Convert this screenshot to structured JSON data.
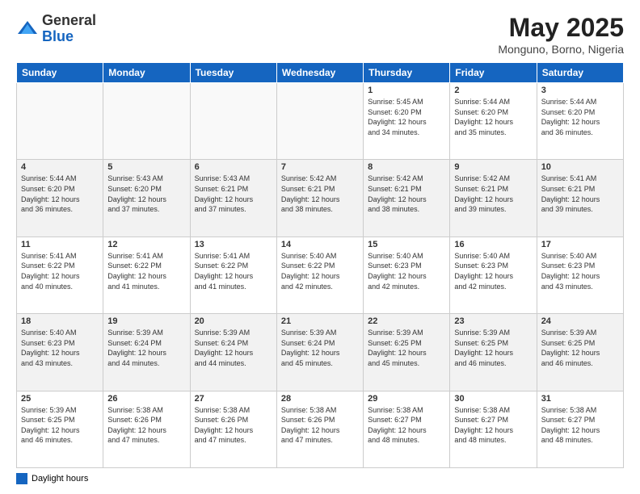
{
  "header": {
    "logo_general": "General",
    "logo_blue": "Blue",
    "month_title": "May 2025",
    "subtitle": "Monguno, Borno, Nigeria"
  },
  "days_of_week": [
    "Sunday",
    "Monday",
    "Tuesday",
    "Wednesday",
    "Thursday",
    "Friday",
    "Saturday"
  ],
  "footer": {
    "legend_label": "Daylight hours"
  },
  "weeks": [
    [
      {
        "day": "",
        "info": ""
      },
      {
        "day": "",
        "info": ""
      },
      {
        "day": "",
        "info": ""
      },
      {
        "day": "",
        "info": ""
      },
      {
        "day": "1",
        "info": "Sunrise: 5:45 AM\nSunset: 6:20 PM\nDaylight: 12 hours\nand 34 minutes."
      },
      {
        "day": "2",
        "info": "Sunrise: 5:44 AM\nSunset: 6:20 PM\nDaylight: 12 hours\nand 35 minutes."
      },
      {
        "day": "3",
        "info": "Sunrise: 5:44 AM\nSunset: 6:20 PM\nDaylight: 12 hours\nand 36 minutes."
      }
    ],
    [
      {
        "day": "4",
        "info": "Sunrise: 5:44 AM\nSunset: 6:20 PM\nDaylight: 12 hours\nand 36 minutes."
      },
      {
        "day": "5",
        "info": "Sunrise: 5:43 AM\nSunset: 6:20 PM\nDaylight: 12 hours\nand 37 minutes."
      },
      {
        "day": "6",
        "info": "Sunrise: 5:43 AM\nSunset: 6:21 PM\nDaylight: 12 hours\nand 37 minutes."
      },
      {
        "day": "7",
        "info": "Sunrise: 5:42 AM\nSunset: 6:21 PM\nDaylight: 12 hours\nand 38 minutes."
      },
      {
        "day": "8",
        "info": "Sunrise: 5:42 AM\nSunset: 6:21 PM\nDaylight: 12 hours\nand 38 minutes."
      },
      {
        "day": "9",
        "info": "Sunrise: 5:42 AM\nSunset: 6:21 PM\nDaylight: 12 hours\nand 39 minutes."
      },
      {
        "day": "10",
        "info": "Sunrise: 5:41 AM\nSunset: 6:21 PM\nDaylight: 12 hours\nand 39 minutes."
      }
    ],
    [
      {
        "day": "11",
        "info": "Sunrise: 5:41 AM\nSunset: 6:22 PM\nDaylight: 12 hours\nand 40 minutes."
      },
      {
        "day": "12",
        "info": "Sunrise: 5:41 AM\nSunset: 6:22 PM\nDaylight: 12 hours\nand 41 minutes."
      },
      {
        "day": "13",
        "info": "Sunrise: 5:41 AM\nSunset: 6:22 PM\nDaylight: 12 hours\nand 41 minutes."
      },
      {
        "day": "14",
        "info": "Sunrise: 5:40 AM\nSunset: 6:22 PM\nDaylight: 12 hours\nand 42 minutes."
      },
      {
        "day": "15",
        "info": "Sunrise: 5:40 AM\nSunset: 6:23 PM\nDaylight: 12 hours\nand 42 minutes."
      },
      {
        "day": "16",
        "info": "Sunrise: 5:40 AM\nSunset: 6:23 PM\nDaylight: 12 hours\nand 42 minutes."
      },
      {
        "day": "17",
        "info": "Sunrise: 5:40 AM\nSunset: 6:23 PM\nDaylight: 12 hours\nand 43 minutes."
      }
    ],
    [
      {
        "day": "18",
        "info": "Sunrise: 5:40 AM\nSunset: 6:23 PM\nDaylight: 12 hours\nand 43 minutes."
      },
      {
        "day": "19",
        "info": "Sunrise: 5:39 AM\nSunset: 6:24 PM\nDaylight: 12 hours\nand 44 minutes."
      },
      {
        "day": "20",
        "info": "Sunrise: 5:39 AM\nSunset: 6:24 PM\nDaylight: 12 hours\nand 44 minutes."
      },
      {
        "day": "21",
        "info": "Sunrise: 5:39 AM\nSunset: 6:24 PM\nDaylight: 12 hours\nand 45 minutes."
      },
      {
        "day": "22",
        "info": "Sunrise: 5:39 AM\nSunset: 6:25 PM\nDaylight: 12 hours\nand 45 minutes."
      },
      {
        "day": "23",
        "info": "Sunrise: 5:39 AM\nSunset: 6:25 PM\nDaylight: 12 hours\nand 46 minutes."
      },
      {
        "day": "24",
        "info": "Sunrise: 5:39 AM\nSunset: 6:25 PM\nDaylight: 12 hours\nand 46 minutes."
      }
    ],
    [
      {
        "day": "25",
        "info": "Sunrise: 5:39 AM\nSunset: 6:25 PM\nDaylight: 12 hours\nand 46 minutes."
      },
      {
        "day": "26",
        "info": "Sunrise: 5:38 AM\nSunset: 6:26 PM\nDaylight: 12 hours\nand 47 minutes."
      },
      {
        "day": "27",
        "info": "Sunrise: 5:38 AM\nSunset: 6:26 PM\nDaylight: 12 hours\nand 47 minutes."
      },
      {
        "day": "28",
        "info": "Sunrise: 5:38 AM\nSunset: 6:26 PM\nDaylight: 12 hours\nand 47 minutes."
      },
      {
        "day": "29",
        "info": "Sunrise: 5:38 AM\nSunset: 6:27 PM\nDaylight: 12 hours\nand 48 minutes."
      },
      {
        "day": "30",
        "info": "Sunrise: 5:38 AM\nSunset: 6:27 PM\nDaylight: 12 hours\nand 48 minutes."
      },
      {
        "day": "31",
        "info": "Sunrise: 5:38 AM\nSunset: 6:27 PM\nDaylight: 12 hours\nand 48 minutes."
      }
    ]
  ]
}
